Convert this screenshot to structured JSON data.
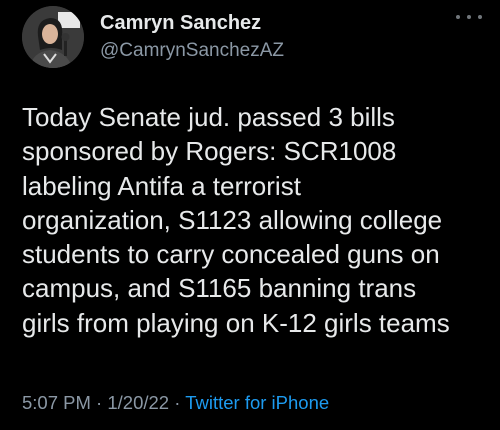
{
  "author": {
    "name": "Camryn Sanchez",
    "handle": "@CamrynSanchezAZ"
  },
  "tweet": {
    "lines": [
      "Today Senate jud. passed 3 bills",
      "sponsored by Rogers: SCR1008",
      "labeling Antifa a terrorist",
      "organization, S1123 allowing college",
      "students to carry concealed guns on",
      "campus, and S1165 banning trans",
      "girls from playing on K-12 girls teams"
    ],
    "time": "5:07 PM",
    "separator1": " · ",
    "date": "1/20/22",
    "separator2": " · ",
    "source": "Twitter for iPhone"
  },
  "icons": {
    "more": "more-icon"
  },
  "colors": {
    "background": "#000000",
    "text": "#e7e9ea",
    "secondary": "#8b98a5",
    "accent": "#1d9bf0"
  }
}
